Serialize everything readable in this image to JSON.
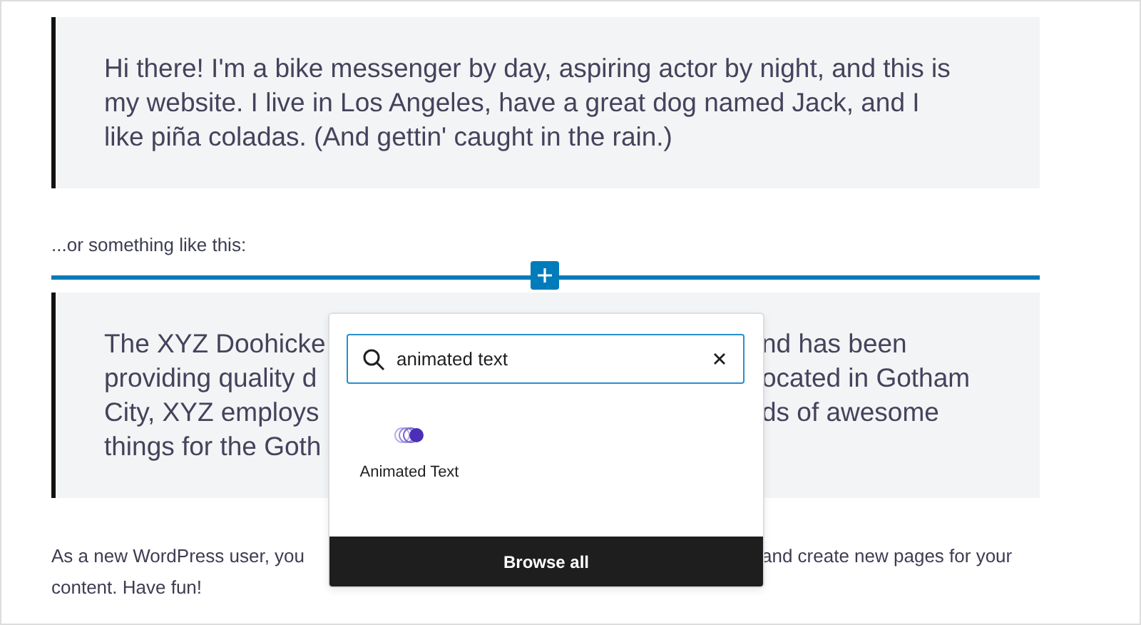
{
  "blocks": [
    {
      "kind": "quote",
      "lines": [
        {
          "left": "Hi there! I'm a bike messenger by day, aspiring actor by night, and this is"
        },
        {
          "left": "my website. I live in Los Angeles, have a great dog named Jack, and I"
        },
        {
          "left": "like piña coladas. (And gettin' caught in the rain.)"
        }
      ]
    },
    {
      "kind": "paragraph",
      "lines": [
        {
          "left": "...or something like this:"
        }
      ]
    },
    {
      "kind": "inserter-line"
    },
    {
      "kind": "quote",
      "lines": [
        {
          "left": "The XYZ Doohicke",
          "right": "nd has been"
        },
        {
          "left": "providing quality d",
          "right": "ocated in Gotham"
        },
        {
          "left": "City, XYZ employs",
          "right": "ds of awesome"
        },
        {
          "left": "things for the Goth"
        }
      ]
    },
    {
      "kind": "paragraph",
      "lines": [
        {
          "left": "As a new WordPress user, you",
          "right": "and create new pages for your"
        },
        {
          "left": "content. Have fun!"
        }
      ]
    }
  ],
  "inserter": {
    "search": {
      "value": "animated text"
    },
    "results": [
      {
        "label": "Animated Text"
      }
    ],
    "footer": "Browse all"
  }
}
